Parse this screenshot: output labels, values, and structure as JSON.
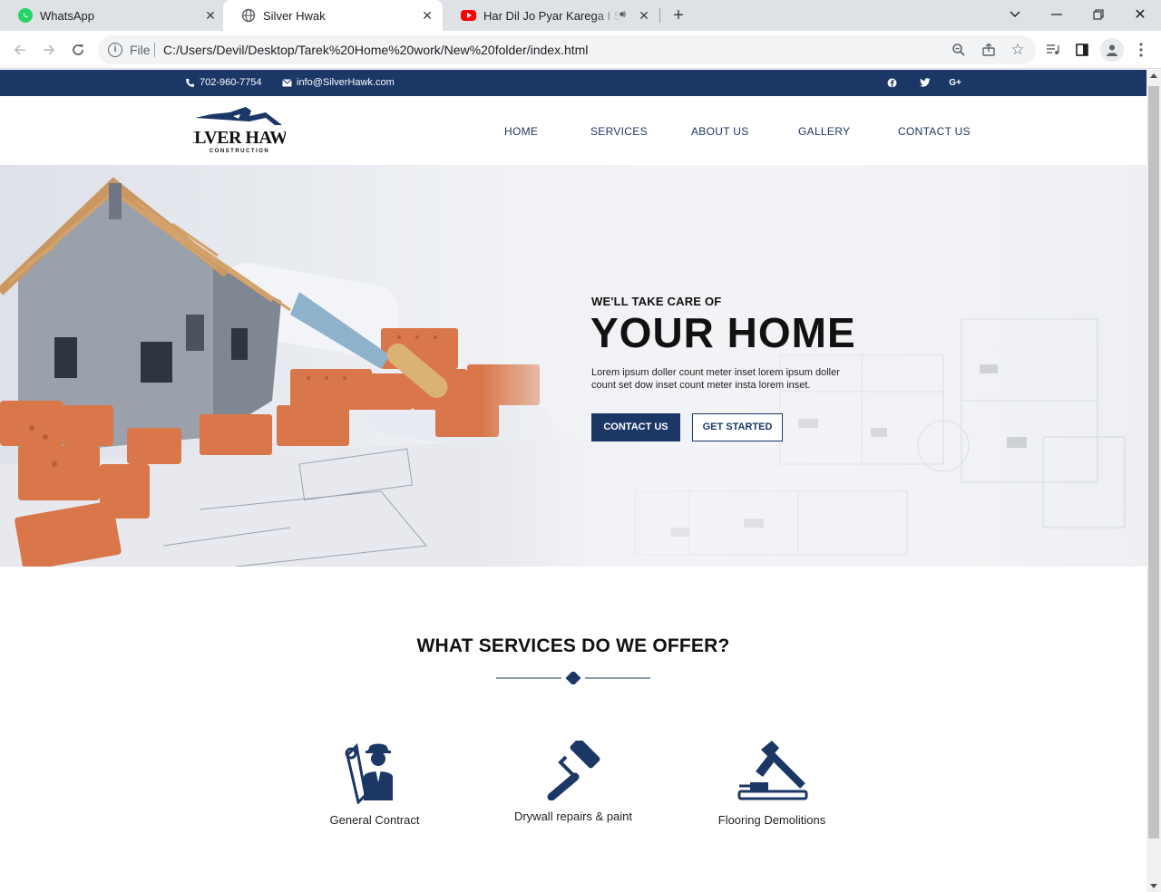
{
  "browser": {
    "tabs": [
      {
        "title": "WhatsApp",
        "active": false
      },
      {
        "title": "Silver Hwak",
        "active": true
      },
      {
        "title": "Har Dil Jo Pyar Karega I Salm",
        "active": false,
        "audio": true
      }
    ],
    "omnibox": {
      "scheme_label": "File",
      "url": "C:/Users/Devil/Desktop/Tarek%20Home%20work/New%20folder/index.html"
    }
  },
  "site": {
    "topbar": {
      "phone": "702-960-7754",
      "email": "info@SilverHawk.com",
      "social": [
        "facebook-icon",
        "twitter-icon",
        "google-plus-icon"
      ]
    },
    "logo": {
      "line1": "SILVER HAWK",
      "line2": "CONSTRUCTION"
    },
    "nav": [
      "HOME",
      "SERVICES",
      "ABOUT US",
      "GALLERY",
      "CONTACT US"
    ],
    "hero": {
      "subtitle": "WE'LL TAKE CARE OF",
      "title": "YOUR HOME",
      "text": "Lorem ipsum doller count meter inset lorem ipsum doller count set dow inset count meter insta lorem inset.",
      "primary_button": "CONTACT US",
      "secondary_button": "GET STARTED"
    },
    "services": {
      "title": "WHAT SERVICES DO WE OFFER?",
      "items": [
        {
          "label": "General Contract",
          "icon": "worker-icon"
        },
        {
          "label": "Drywall repairs & paint",
          "icon": "paint-roller-icon"
        },
        {
          "label": "Flooring Demolitions",
          "icon": "hammer-icon"
        }
      ]
    }
  },
  "colors": {
    "brand": "#1b3766",
    "tabbar": "#dee1e6"
  }
}
